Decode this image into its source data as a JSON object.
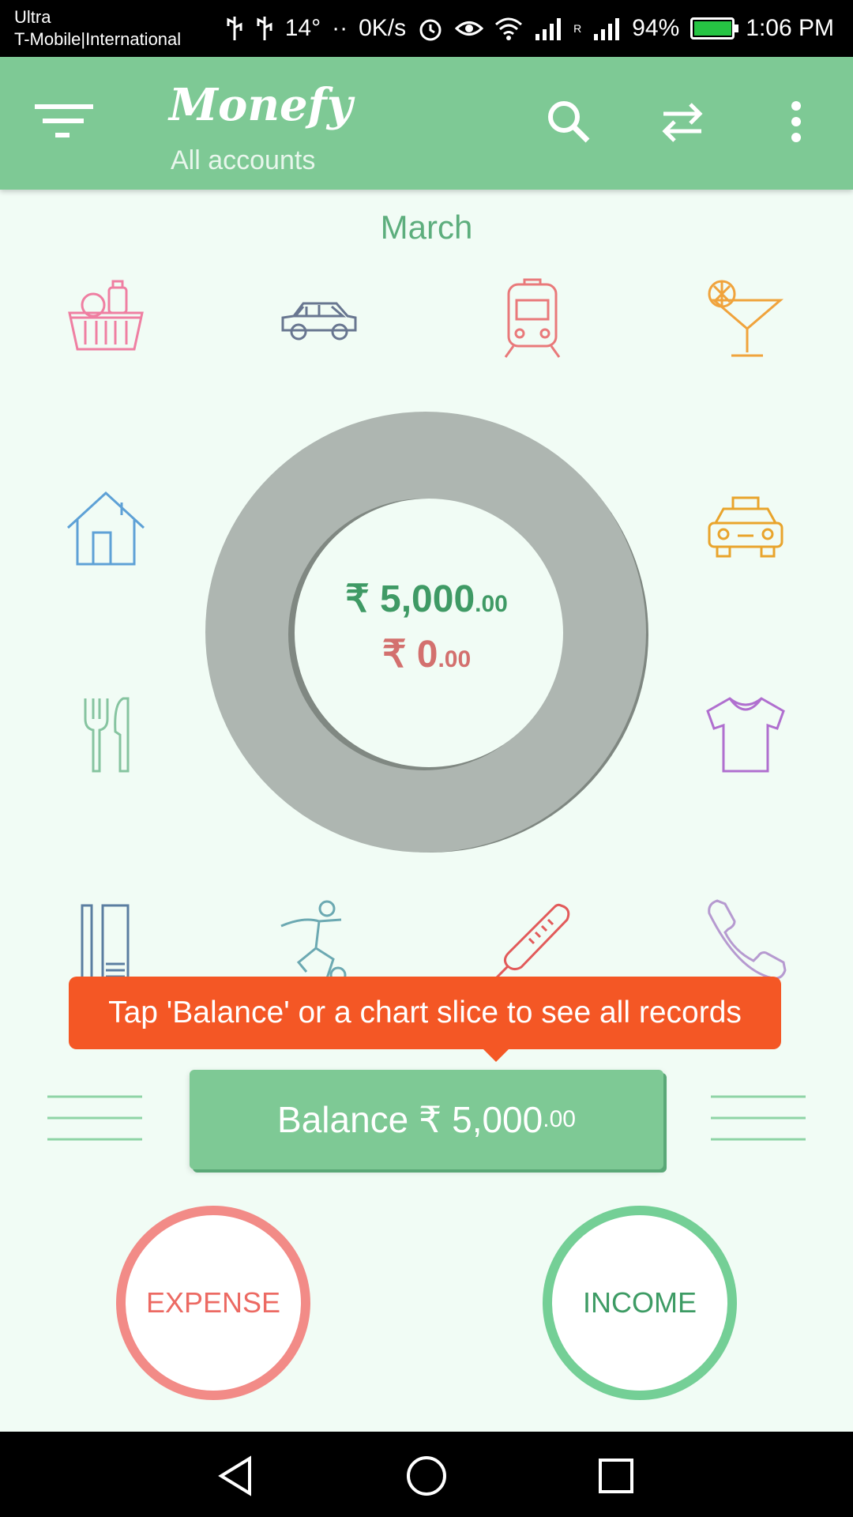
{
  "status_bar": {
    "carrier_line1": "Ultra",
    "carrier_line2": "T-Mobile|International",
    "temperature": "14°",
    "dots": "··",
    "network_speed": "0K/s",
    "roaming": "R",
    "battery": "94%",
    "battery_level": 0.94,
    "time": "1:06 PM"
  },
  "app_bar": {
    "title": "Monefy",
    "subtitle": "All accounts",
    "icons": [
      "menu-icon",
      "search-icon",
      "transfer-icon",
      "more-vert-icon"
    ]
  },
  "month": "March",
  "categories": [
    {
      "name": "groceries",
      "color": "#ef7fa2"
    },
    {
      "name": "car",
      "color": "#687690"
    },
    {
      "name": "transport",
      "color": "#e9797a"
    },
    {
      "name": "entertainment",
      "color": "#f0a33c"
    },
    {
      "name": "house",
      "color": "#5ea1d6"
    },
    {
      "name": "taxi",
      "color": "#e9a42c"
    },
    {
      "name": "eating-out",
      "color": "#86c4a0"
    },
    {
      "name": "clothes",
      "color": "#b06fcf"
    },
    {
      "name": "toiletry",
      "color": "#5b7ea1"
    },
    {
      "name": "sports",
      "color": "#6ca9b2"
    },
    {
      "name": "health",
      "color": "#e25a5a"
    },
    {
      "name": "communications",
      "color": "#b69ad0"
    }
  ],
  "chart": {
    "income": {
      "symbol": "₹",
      "main": "5,000",
      "cents": ".00"
    },
    "expense": {
      "symbol": "₹",
      "main": "0",
      "cents": ".00"
    },
    "ring_color": "#aeb6b1"
  },
  "tooltip": "Tap 'Balance' or a chart slice to see all records",
  "balance": {
    "label": "Balance",
    "symbol": "₹",
    "main": "5,000",
    "cents": ".00"
  },
  "expense_button": "EXPENSE",
  "income_button": "INCOME",
  "colors": {
    "primary": "#7ec995",
    "accent": "#f45725",
    "expense": "#f28b87",
    "income": "#74cf96"
  }
}
